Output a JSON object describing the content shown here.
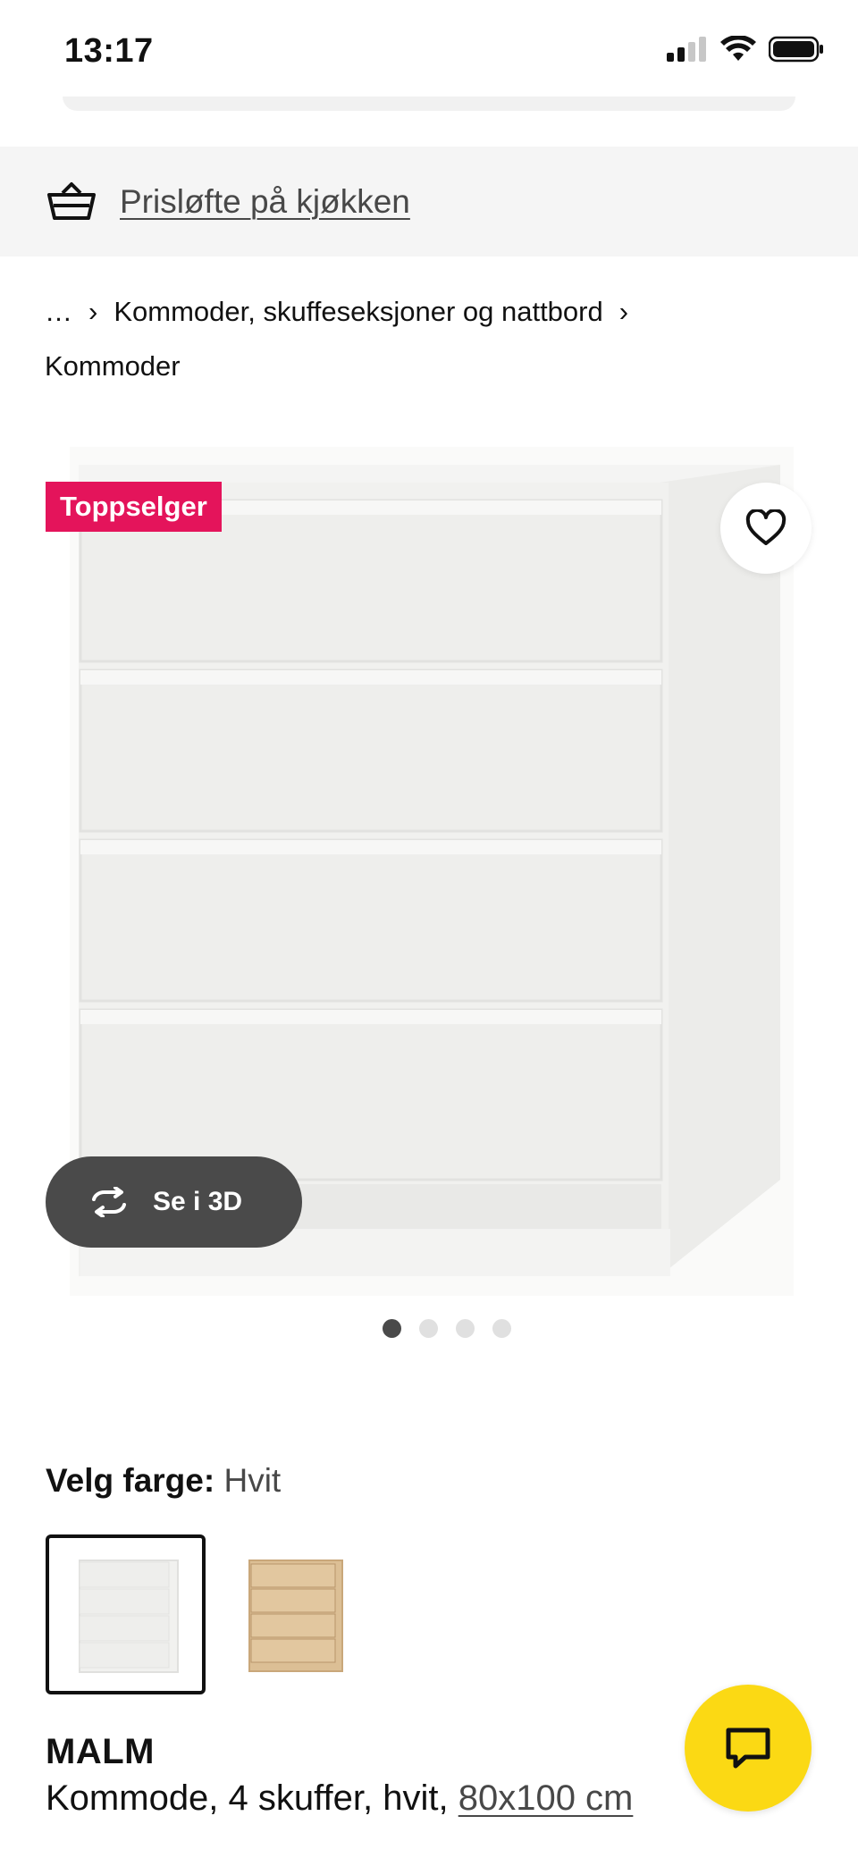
{
  "status_bar": {
    "time": "13:17",
    "icons": [
      "cellular-signal-icon",
      "wifi-icon",
      "battery-icon"
    ]
  },
  "promo": {
    "icon": "basket-icon",
    "link_text": "Prisløfte på kjøkken"
  },
  "breadcrumb": {
    "items": [
      "…",
      "Kommoder, skuffeseksjoner og nattbord",
      "Kommoder"
    ],
    "separator": "›"
  },
  "gallery": {
    "badge": "Toppselger",
    "favorite_icon": "heart-icon",
    "view_3d_label": "Se i 3D",
    "view_3d_icon": "rotate-icon",
    "image_count": 4,
    "active_index": 0
  },
  "color_picker": {
    "label": "Velg farge:",
    "value": "Hvit",
    "options": [
      "Hvit",
      "Eik"
    ],
    "selected_index": 0
  },
  "product": {
    "name": "MALM",
    "description": "Kommode, 4 skuffer, hvit, ",
    "size": "80x100 cm"
  },
  "chat": {
    "icon": "chat-bubble-icon"
  },
  "colors": {
    "badge": "#e4145b",
    "chat_button": "#fbd914",
    "view_3d_button": "#4a4a4a",
    "promo_bg": "#f5f5f5"
  }
}
